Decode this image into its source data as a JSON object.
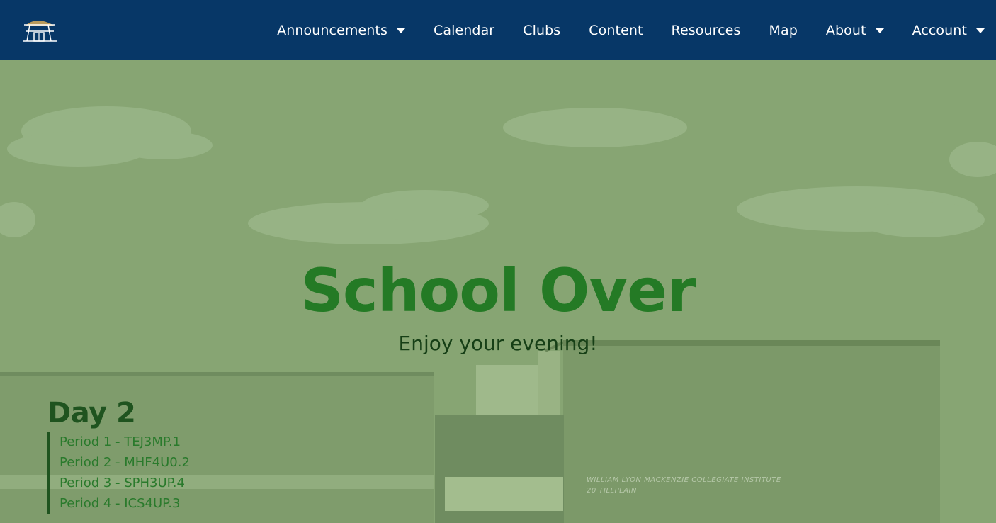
{
  "nav": {
    "items": [
      {
        "label": "Announcements",
        "dropdown": true
      },
      {
        "label": "Calendar",
        "dropdown": false
      },
      {
        "label": "Clubs",
        "dropdown": false
      },
      {
        "label": "Content",
        "dropdown": false
      },
      {
        "label": "Resources",
        "dropdown": false
      },
      {
        "label": "Map",
        "dropdown": false
      },
      {
        "label": "About",
        "dropdown": true
      },
      {
        "label": "Account",
        "dropdown": true
      }
    ]
  },
  "hero": {
    "title": "School Over",
    "subtitle": "Enjoy your evening!"
  },
  "schedule": {
    "day": "Day 2",
    "periods": [
      "Period 1 - TEJ3MP.1",
      "Period 2 - MHF4U0.2",
      "Period 3 - SPH3UP.4",
      "Period 4 - ICS4UP.3"
    ]
  },
  "building_sign": {
    "line1": "WILLIAM LYON MACKENZIE COLLEGIATE INSTITUTE",
    "line2": "20 TILLPLAIN"
  },
  "colors": {
    "navbar": "#073767",
    "overlay": "#87a573",
    "title": "#247a25",
    "day_title": "#1f531f",
    "period_text": "#2a7a2c",
    "logo_gold": "#b89a5c"
  }
}
